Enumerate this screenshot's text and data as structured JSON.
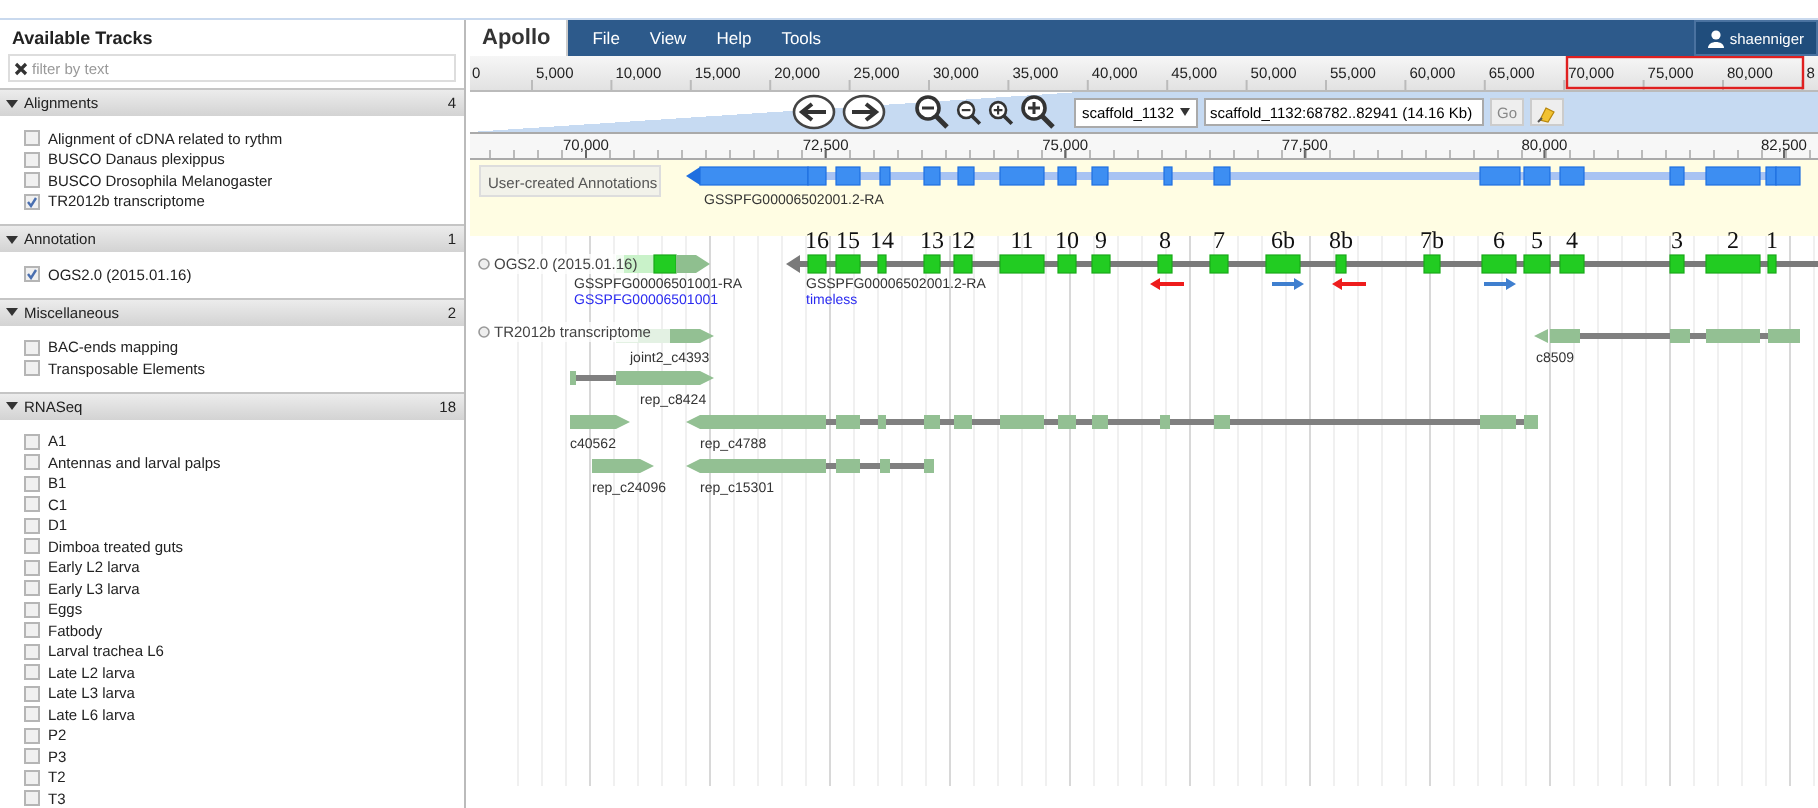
{
  "sidebar": {
    "title": "Available Tracks",
    "filter": {
      "placeholder": "filter by text"
    },
    "categories": [
      {
        "name": "Alignments",
        "count": "4",
        "expanded": true,
        "tracks": [
          {
            "label": "Alignment of cDNA related to rythm",
            "checked": false
          },
          {
            "label": "BUSCO Danaus plexippus",
            "checked": false
          },
          {
            "label": "BUSCO Drosophila Melanogaster",
            "checked": false
          },
          {
            "label": "TR2012b transcriptome",
            "checked": true
          }
        ]
      },
      {
        "name": "Annotation",
        "count": "1",
        "expanded": true,
        "tracks": [
          {
            "label": "OGS2.0 (2015.01.16)",
            "checked": true
          }
        ]
      },
      {
        "name": "Miscellaneous",
        "count": "2",
        "expanded": true,
        "tracks": [
          {
            "label": "BAC-ends mapping",
            "checked": false
          },
          {
            "label": "Transposable Elements",
            "checked": false
          }
        ]
      },
      {
        "name": "RNASeq",
        "count": "18",
        "expanded": true,
        "tracks": [
          {
            "label": "A1",
            "checked": false
          },
          {
            "label": "Antennas and larval palps",
            "checked": false
          },
          {
            "label": "B1",
            "checked": false
          },
          {
            "label": "C1",
            "checked": false
          },
          {
            "label": "D1",
            "checked": false
          },
          {
            "label": "Dimboa treated guts",
            "checked": false
          },
          {
            "label": "Early L2 larva",
            "checked": false
          },
          {
            "label": "Early L3 larva",
            "checked": false
          },
          {
            "label": "Eggs",
            "checked": false
          },
          {
            "label": "Fatbody",
            "checked": false
          },
          {
            "label": "Larval trachea L6",
            "checked": false
          },
          {
            "label": "Late L2 larva",
            "checked": false
          },
          {
            "label": "Late L3 larva",
            "checked": false
          },
          {
            "label": "Late L6 larva",
            "checked": false
          },
          {
            "label": "P2",
            "checked": false
          },
          {
            "label": "P3",
            "checked": false
          },
          {
            "label": "T2",
            "checked": false
          },
          {
            "label": "T3",
            "checked": false
          }
        ]
      }
    ]
  },
  "navbar": {
    "logo": "Apollo",
    "menus": [
      "File",
      "View",
      "Help",
      "Tools"
    ],
    "user": "shaenniger"
  },
  "overview_ruler": [
    "0",
    "5,000",
    "10,000",
    "15,000",
    "20,000",
    "25,000",
    "30,000",
    "35,000",
    "40,000",
    "45,000",
    "50,000",
    "55,000",
    "60,000",
    "65,000",
    "70,000",
    "75,000",
    "80,000",
    "8"
  ],
  "navigation": {
    "reference": "scaffold_1132",
    "location": "scaffold_1132:68782..82941 (14.16 Kb)",
    "go": "Go"
  },
  "detail_ruler": [
    "70,000",
    "72,500",
    "75,000",
    "77,500",
    "80,000",
    "82,500"
  ],
  "tracks": [
    {
      "kind": "annotations",
      "label": "User-created Annotations",
      "features": [
        {
          "name": "GSSPFG00006502001.2-RA"
        }
      ]
    },
    {
      "kind": "gene",
      "label": "OGS2.0 (2015.01.16)",
      "features": [
        {
          "name": "GSSPFG00006501001-RA",
          "gene": "GSSPFG00006501001"
        },
        {
          "name": "GSSPFG00006502001.2-RA",
          "gene": "timeless",
          "exons": [
            "16",
            "15",
            "14",
            "13",
            "12",
            "11",
            "10",
            "9",
            "8",
            "7",
            "6b",
            "8b",
            "7b",
            "6",
            "5",
            "4",
            "3",
            "2",
            "1"
          ]
        }
      ],
      "strand_marks": [
        {
          "leftward": true,
          "color": "#ee1c1c"
        },
        {
          "leftward": false,
          "color": "#3f7fcf"
        },
        {
          "leftward": true,
          "color": "#ee1c1c"
        },
        {
          "leftward": false,
          "color": "#3f7fcf"
        }
      ]
    },
    {
      "kind": "alignments",
      "label": "TR2012b transcriptome",
      "features": [
        {
          "name": "joint2_c4393"
        },
        {
          "name": "c8509"
        },
        {
          "name": "rep_c8424"
        },
        {
          "name": "c40562"
        },
        {
          "name": "rep_c4788"
        },
        {
          "name": "rep_c24096"
        },
        {
          "name": "rep_c15301"
        }
      ]
    }
  ]
}
